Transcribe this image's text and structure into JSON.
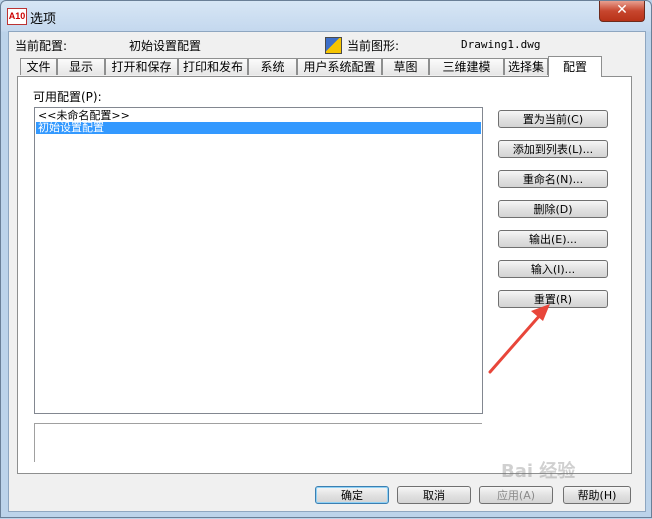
{
  "window": {
    "title": "选项",
    "app_icon_text": "A10",
    "close_symbol": "✕"
  },
  "header": {
    "current_profile_label": "当前配置:",
    "current_profile_value": "初始设置配置",
    "current_drawing_label": "当前图形:",
    "current_drawing_value": "Drawing1.dwg"
  },
  "tabs": [
    {
      "label": "文件"
    },
    {
      "label": "显示"
    },
    {
      "label": "打开和保存"
    },
    {
      "label": "打印和发布"
    },
    {
      "label": "系统"
    },
    {
      "label": "用户系统配置"
    },
    {
      "label": "草图"
    },
    {
      "label": "三维建模"
    },
    {
      "label": "选择集"
    },
    {
      "label": "配置",
      "active": true
    }
  ],
  "profiles": {
    "label": "可用配置(P):",
    "items": [
      {
        "text": "<<未命名配置>>",
        "selected": false
      },
      {
        "text": "初始设置配置",
        "selected": true
      }
    ]
  },
  "side_buttons": {
    "set_current": "置为当前(C)",
    "add_to_list": "添加到列表(L)...",
    "rename": "重命名(N)...",
    "delete": "删除(D)",
    "export": "输出(E)...",
    "import": "输入(I)...",
    "reset": "重置(R)"
  },
  "footer": {
    "ok": "确定",
    "cancel": "取消",
    "apply": "应用(A)",
    "help": "帮助(H)"
  },
  "watermark": "Bai 经验",
  "colors": {
    "selection": "#3399ff",
    "annotation_arrow": "#e8463a"
  }
}
